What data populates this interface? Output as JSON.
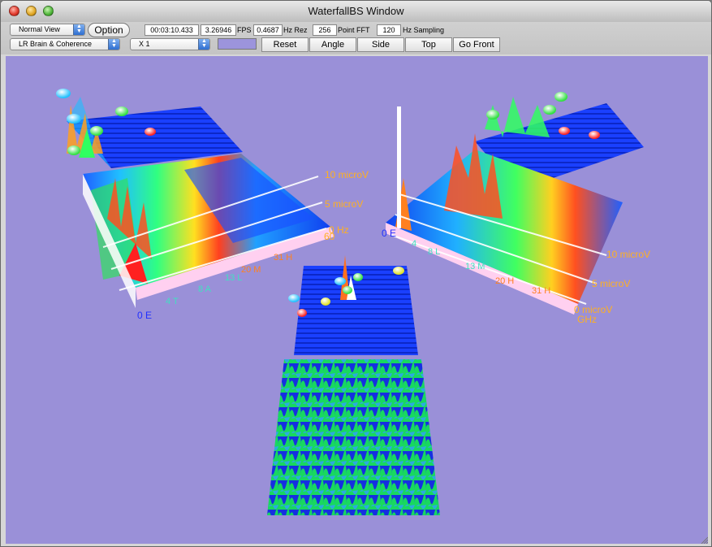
{
  "window": {
    "title": "WaterfallBS Window"
  },
  "toolbar": {
    "view_select": "Normal View",
    "mode_select": "LR Brain & Coherence",
    "scale_select": "X 1",
    "option_label": "Option",
    "elapsed": "00:03:10.433",
    "fps_value": "3.26946",
    "fps_label": "FPS",
    "hz_rez_value": "0.4687",
    "hz_rez_label": "Hz Rez",
    "fft_value": "256",
    "fft_label": "Point FFT",
    "sampling_value": "120",
    "sampling_label": "Hz Sampling",
    "color_swatch": "#9c94dc",
    "buttons": [
      "Reset",
      "Angle",
      "Side",
      "Top",
      "Go Front"
    ]
  },
  "view": {
    "background": "#9a90d8",
    "left_labels": {
      "hi": "10 microV",
      "mid": "5 microV",
      "low": "0 Hz",
      "axis_zero": "0 E",
      "axis_end": "60"
    },
    "right_labels": {
      "hi": "10 microV",
      "mid": "5 microV",
      "low": "0 microV",
      "axis_zero": "0 E",
      "axis_end": "GHz"
    },
    "left_axis_letters": [
      "4 T",
      "8 A",
      "13 L",
      "20 M",
      "31 H"
    ],
    "right_axis_letters": [
      "4",
      "8 L",
      "13 M",
      "20 H",
      "31 H"
    ]
  }
}
